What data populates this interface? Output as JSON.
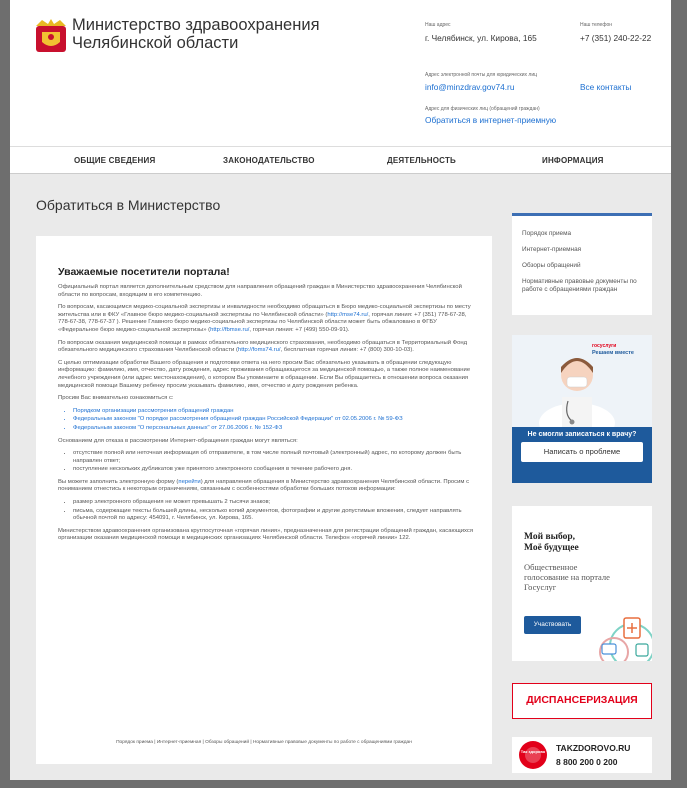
{
  "header": {
    "org_line1": "Министерство здравоохранения",
    "org_line2": "Челябинской области",
    "address_label": "Наш адрес",
    "address": "г. Челябинск, ул. Кирова, 165",
    "phone_label": "Наш телефон",
    "phone": "+7 (351) 240-22-22",
    "email_label": "Адрес электронной почты для юридических лиц",
    "email": "info@minzdrav.gov74.ru",
    "all_contacts": "Все контакты",
    "reception_label": "Адрес для физических лиц (обращений граждан)",
    "reception_link": "Обратиться в интернет-приемную"
  },
  "nav": {
    "items": [
      "ОБЩИЕ СВЕДЕНИЯ",
      "ЗАКОНОДАТЕЛЬСТВО",
      "ДЕЯТЕЛЬНОСТЬ",
      "ИНФОРМАЦИЯ"
    ]
  },
  "page": {
    "title": "Обратиться в Министерство"
  },
  "content": {
    "heading": "Уважаемые посетители портала!",
    "p1": "Официальный портал является дополнительным средством для направления обращений граждан в Министерство здравоохранения Челябинской области по вопросам, входящим в его компетенцию.",
    "p2_a": "По вопросам, касающимся медико-социальной экспертизы и инвалидности необходимо обращаться в Бюро медико-социальной экспертизы по месту жительства или в ФКУ «Главное бюро медико-социальной экспертизы по Челябинской области» (",
    "p2_link1": "http://mse74.ru/",
    "p2_b": ", горячая линия: +7 (351) 778-67-28, 778-67-38, 778-67-37 ). Решение Главного бюро медико-социальной экспертизы по Челябинской области может быть обжаловано в ФГБУ «Федеральное бюро медико-социальной экспертизы» (",
    "p2_link2": "http://fbmse.ru/",
    "p2_c": ", горячая линия: +7 (499) 550-09-91).",
    "p3_a": "По вопросам оказания медицинской помощи в рамках обязательного медицинского страхования, необходимо обращаться в Территориальный Фонд обязательного медицинского страхования Челябинской области (",
    "p3_link": "http://foms74.ru/",
    "p3_b": ", бесплатная горячая линия: +7 (800) 300-10-03).",
    "p4": "С целью оптимизации обработки Вашего обращения и подготовки ответа на него просим Вас обязательно указывать в обращении следующую информацию: фамилию, имя, отчество, дату рождения, адрес проживания обращающегося за медицинской помощью, а также полное наименование лечебного учреждения (или адрес местонахождения), о котором Вы упоминаете в обращении. Если Вы обращаетесь в отношении вопроса оказания медицинской помощи Вашему ребенку просим указывать фамилию, имя, отчество и дату рождения ребенка.",
    "p5": "Просим Вас внимательно ознакомиться с:",
    "list1": [
      "Порядком организации рассмотрения обращений граждан",
      "Федеральным законом \"О порядке рассмотрения обращений граждан Российской Федерации\" от 02.05.2006 г. № 59-ФЗ",
      "Федеральным законом \"О персональных данных\" от 27.06.2006 г. № 152-ФЗ"
    ],
    "p6": "Основанием для отказа в рассмотрении Интернет-обращения граждан могут являться:",
    "list2": [
      "отсутствие полной или неточная информация об отправителе, в том числе полный почтовый (электронный) адрес, по которому должен быть направлен ответ;",
      "поступление нескольких дубликатов уже принятого электронного сообщения в течение рабочего дня."
    ],
    "p7_a": "Вы можете заполнить электронную форму (",
    "p7_link": "перейти",
    "p7_b": ") для направления обращения в Министерство здравоохранения Челябинской области. Просим с пониманием отнестись к некоторым ограничениям, связанным с особенностями обработки больших потоков информации:",
    "list3": [
      "размер электронного обращения не может превышать 2 тысячи знаков;",
      "письма, содержащие тексты большей длины, несколько копий документов, фотографии и другие допустимые вложения, следует направлять обычной почтой по адресу: 454091, г. Челябинск, ул. Кирова, 165."
    ],
    "p8": "Министерством здравоохранения организована круглосуточная «горячая линия», предназначенная для регистрации обращений граждан, касающихся организации оказания медицинской помощи в медицинских организациях Челябинской области. Телефон «горячей линии» 122.",
    "footer": "Порядок приема | Интернет-приемная | Обзоры обращений | Нормативные правовые документы по работе с обращениями граждан"
  },
  "sidebar": {
    "items": [
      "Порядок приема",
      "Интернет-приемная",
      "Обзоры обращений",
      "Нормативные правовые документы по работе с обращениями граждан"
    ]
  },
  "ads": {
    "gosuslugi_small": "госуслуги",
    "gosuslugi_tag": "Решаем вместе",
    "doctor_question": "Не смогли записаться к врачу?",
    "doctor_button": "Написать о проблеме",
    "vote_title1": "Мой выбор,",
    "vote_title2": "Моё будущее",
    "vote_text1": "Общественное",
    "vote_text2": "голосование на портале",
    "vote_text3": "Госуслуг",
    "vote_button": "Участвовать",
    "dispanser": "ДИСПАНСЕРИЗАЦИЯ",
    "takz_site": "TAKZDOROVO.RU",
    "takz_phone": "8 800 200 0 200",
    "takz_logo": "Так здорово"
  }
}
